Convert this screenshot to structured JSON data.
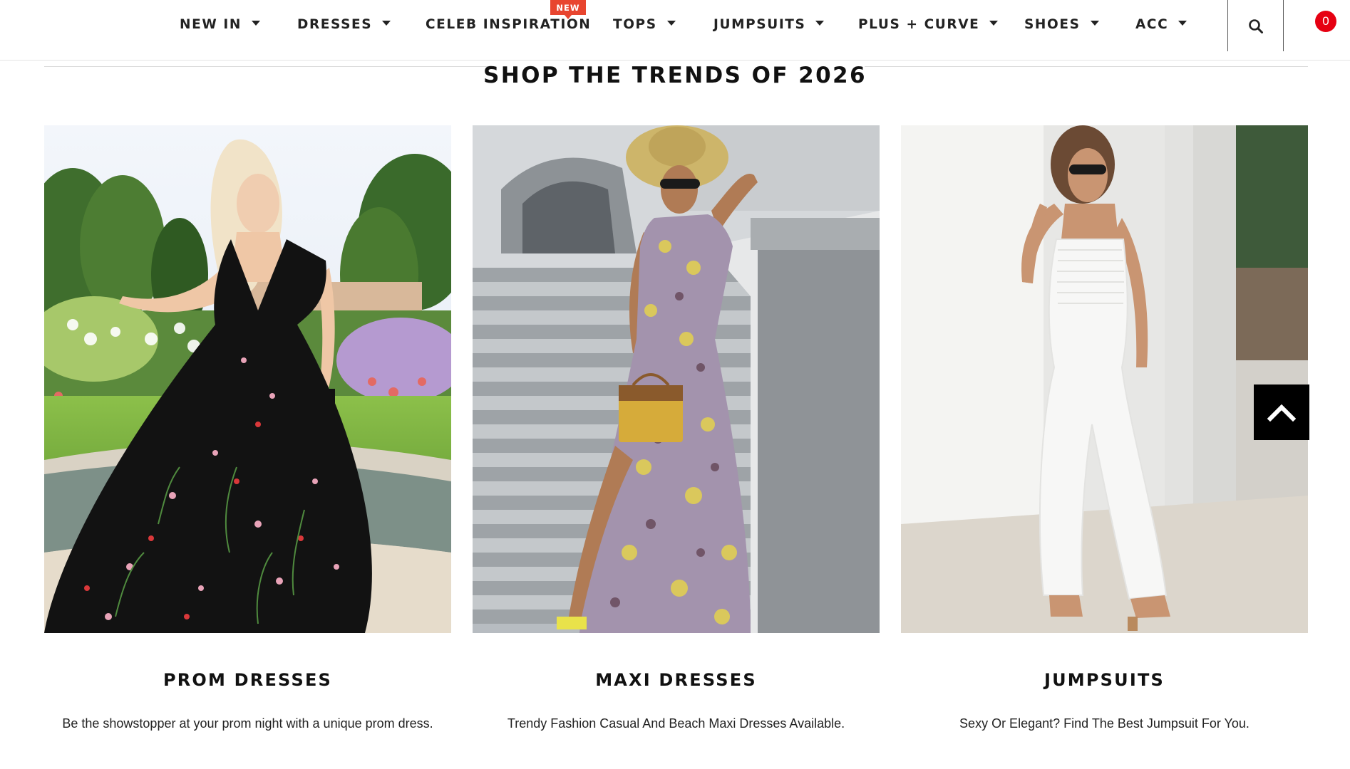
{
  "nav": {
    "items": [
      {
        "label": "NEW IN",
        "has_dropdown": true
      },
      {
        "label": "DRESSES",
        "has_dropdown": true
      },
      {
        "label": "CELEB INSPIRATION",
        "has_dropdown": false,
        "badge": "NEW"
      },
      {
        "label": "TOPS",
        "has_dropdown": true
      },
      {
        "label": "JUMPSUITS",
        "has_dropdown": true
      },
      {
        "label": "PLUS + CURVE",
        "has_dropdown": true
      },
      {
        "label": "SHOES",
        "has_dropdown": true
      },
      {
        "label": "ACC",
        "has_dropdown": true
      }
    ],
    "search_icon": "search-icon",
    "cart": {
      "icon": "cart-icon",
      "count": "0"
    }
  },
  "section": {
    "title": "SHOP THE TRENDS OF 2026"
  },
  "cards": [
    {
      "title": "PROM DRESSES",
      "description": "Be the showstopper at your prom night with a unique prom dress.",
      "image": "woman in black floral embroidered gown in a garden"
    },
    {
      "title": "MAXI DRESSES",
      "description": "Trendy Fashion Casual And Beach Maxi Dresses Available.",
      "image": "woman in floral print maxi dress with sun hat on stone steps"
    },
    {
      "title": "JUMPSUITS",
      "description": "Sexy Or Elegant? Find The Best Jumpsuit For You.",
      "image": "woman in white smocked jumpsuit against a white wall"
    }
  ],
  "back_to_top": {
    "icon": "chevron-up-icon"
  },
  "colors": {
    "badge": "#e8452f",
    "cart_badge": "#e60012",
    "text": "#111111",
    "back_to_top_bg": "#000000"
  }
}
